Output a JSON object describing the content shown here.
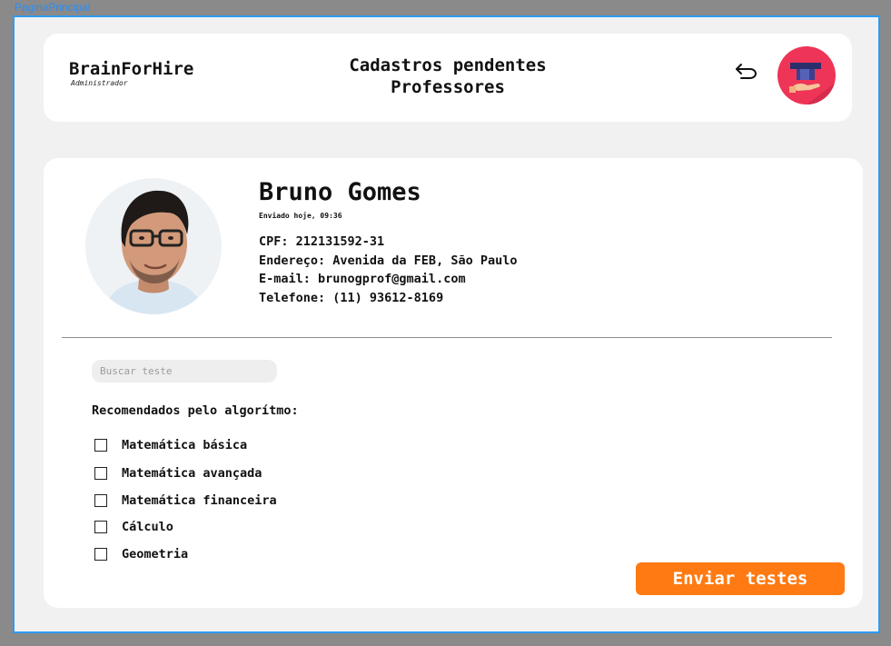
{
  "frame": {
    "label": "PaginaPrincipal"
  },
  "header": {
    "brand_name": "BrainForHire",
    "brand_subtitle": "Administrador",
    "title_line1": "Cadastros pendentes",
    "title_line2": "Professores",
    "back_icon": "undo-arrow-icon",
    "logo_icon": "graduation-cap-hand-icon"
  },
  "profile": {
    "name": "Bruno Gomes",
    "sent_at": "Enviado hoje, 09:36",
    "cpf": "CPF: 212131592-31",
    "address": "Endereço: Avenida da FEB, São Paulo",
    "email": "E-mail: brunogprof@gmail.com",
    "phone": "Telefone: (11) 93612-8169"
  },
  "search": {
    "placeholder": "Buscar teste",
    "value": ""
  },
  "recommended": {
    "title": "Recomendados pelo algorítmo:",
    "tests": [
      {
        "label": "Matemática básica",
        "checked": false
      },
      {
        "label": "Matemática avançada",
        "checked": false
      },
      {
        "label": "Matemática financeira",
        "checked": false
      },
      {
        "label": "Cálculo",
        "checked": false
      },
      {
        "label": "Geometria",
        "checked": false
      }
    ]
  },
  "actions": {
    "send_label": "Enviar testes"
  },
  "colors": {
    "accent": "#ff7a12",
    "logo_bg": "#ee3557",
    "frame_border": "#2d9cf5"
  }
}
